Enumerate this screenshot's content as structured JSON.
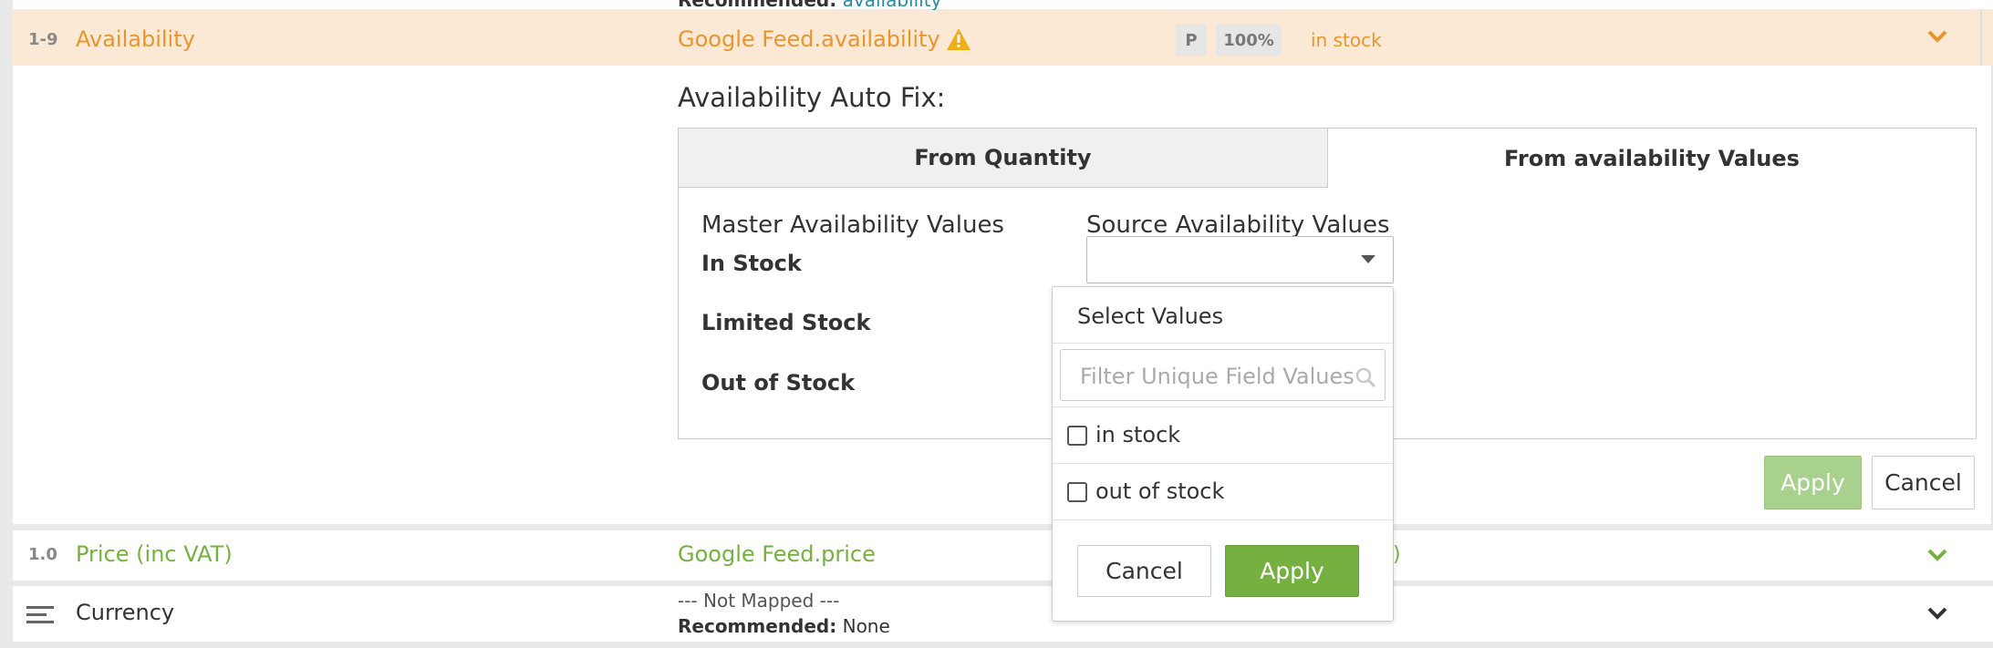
{
  "top_hint": {
    "label": "Recommended:",
    "value": "availability"
  },
  "rows": [
    {
      "index": "1-9",
      "name": "Availability",
      "mapping": "Google Feed.availability",
      "badge_p": "P",
      "badge_pct": "100%",
      "sample": "in stock"
    },
    {
      "index": "1.0",
      "name": "Price (inc VAT)",
      "mapping": "Google Feed.price",
      "sample_fragment": ")"
    },
    {
      "name": "Currency",
      "mapping": "--- Not Mapped ---",
      "recommended_label": "Recommended:",
      "recommended_value": "None"
    }
  ],
  "autofix": {
    "title": "Availability Auto Fix:",
    "tabs": [
      {
        "label": "From Quantity",
        "active": false
      },
      {
        "label": "From availability Values",
        "active": true
      }
    ],
    "master_header": "Master Availability Values",
    "source_header": "Source Availability Values",
    "master_values": [
      "In Stock",
      "Limited Stock",
      "Out of Stock"
    ],
    "apply_label": "Apply",
    "cancel_label": "Cancel"
  },
  "dropdown": {
    "title": "Select Values",
    "filter_placeholder": "Filter Unique Field Values",
    "options": [
      "in stock",
      "out of stock"
    ],
    "cancel_label": "Cancel",
    "apply_label": "Apply"
  },
  "colors": {
    "orange": "#e8962c",
    "green": "#76b041",
    "highlight_bg": "#fbe9d6"
  }
}
